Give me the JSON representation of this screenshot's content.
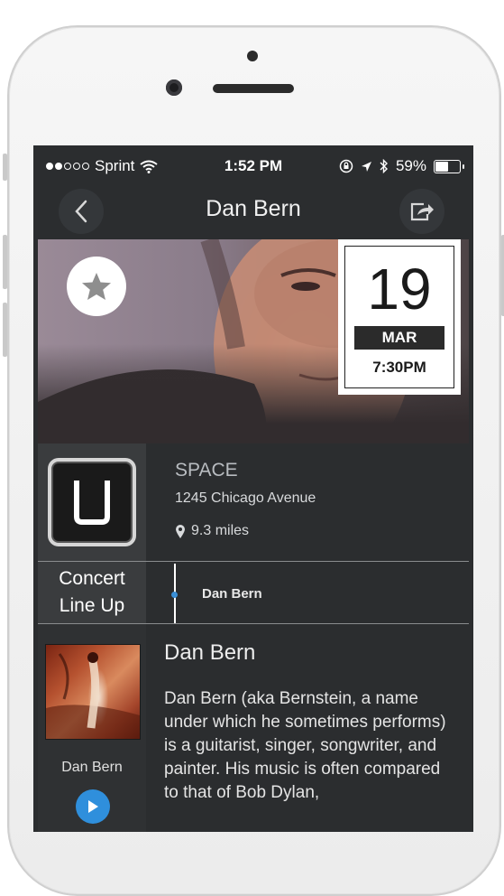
{
  "status_bar": {
    "carrier": "Sprint",
    "time": "1:52 PM",
    "battery_percent": "59%",
    "battery_level": 0.59,
    "signal_bars_filled": 2,
    "signal_bars_total": 5
  },
  "nav": {
    "title": "Dan Bern",
    "back_icon": "chevron-left-icon",
    "share_icon": "share-icon"
  },
  "event": {
    "day": "19",
    "month": "MAR",
    "time": "7:30PM",
    "favorite_icon": "star-icon"
  },
  "venue": {
    "name": "SPACE",
    "address": "1245 Chicago Avenue",
    "distance": "9.3 miles",
    "logo": "uber-logo"
  },
  "lineup": {
    "label_line1": "Concert",
    "label_line2": "Line Up",
    "artists": [
      "Dan Bern"
    ]
  },
  "artist": {
    "name": "Dan Bern",
    "album_caption": "Dan Bern",
    "bio": "Dan Bern (aka Bernstein, a name under which he sometimes performs) is a guitarist, singer, songwriter, and painter. His music is often compared to that of Bob Dylan,"
  },
  "colors": {
    "screen_bg": "#2b2d2f",
    "accent_blue": "#2f8fdc"
  }
}
